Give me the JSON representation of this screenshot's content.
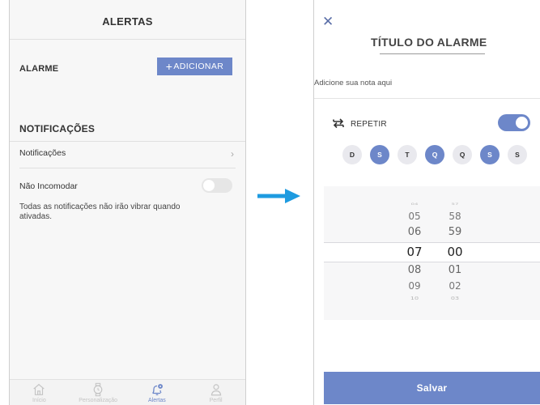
{
  "alerts_screen": {
    "title": "ALERTAS",
    "alarm_label": "ALARME",
    "add_button_label": "ADICIONAR",
    "notifications_section_title": "NOTIFICAÇÕES",
    "notifications_row_label": "Notificações",
    "dnd_label": "Não Incomodar",
    "dnd_enabled": false,
    "dnd_description": "Todas as notificações não irão vibrar quando ativadas.",
    "tabs": [
      {
        "label": "Início",
        "icon": "home-icon",
        "active": false
      },
      {
        "label": "Personalização",
        "icon": "watch-icon",
        "active": false
      },
      {
        "label": "Alertas",
        "icon": "bell-settings-icon",
        "active": true
      },
      {
        "label": "Perfil",
        "icon": "user-icon",
        "active": false
      }
    ]
  },
  "alarm_screen": {
    "close_icon": "close-icon",
    "title": "TÍTULO DO ALARME",
    "note_placeholder": "Adicione sua nota aqui",
    "repeat_label": "REPETIR",
    "repeat_enabled": true,
    "days": [
      {
        "label": "D",
        "selected": false
      },
      {
        "label": "S",
        "selected": true
      },
      {
        "label": "T",
        "selected": false
      },
      {
        "label": "Q",
        "selected": true
      },
      {
        "label": "Q",
        "selected": false
      },
      {
        "label": "S",
        "selected": true
      },
      {
        "label": "S",
        "selected": false
      }
    ],
    "hours": [
      "04",
      "05",
      "06",
      "07",
      "08",
      "09",
      "10"
    ],
    "minutes": [
      "57",
      "58",
      "59",
      "00",
      "01",
      "02",
      "03"
    ],
    "selected_time": "07:00",
    "save_button_label": "Salvar"
  },
  "colors": {
    "accent": "#6d87c9",
    "flow_arrow": "#1e9be0"
  }
}
